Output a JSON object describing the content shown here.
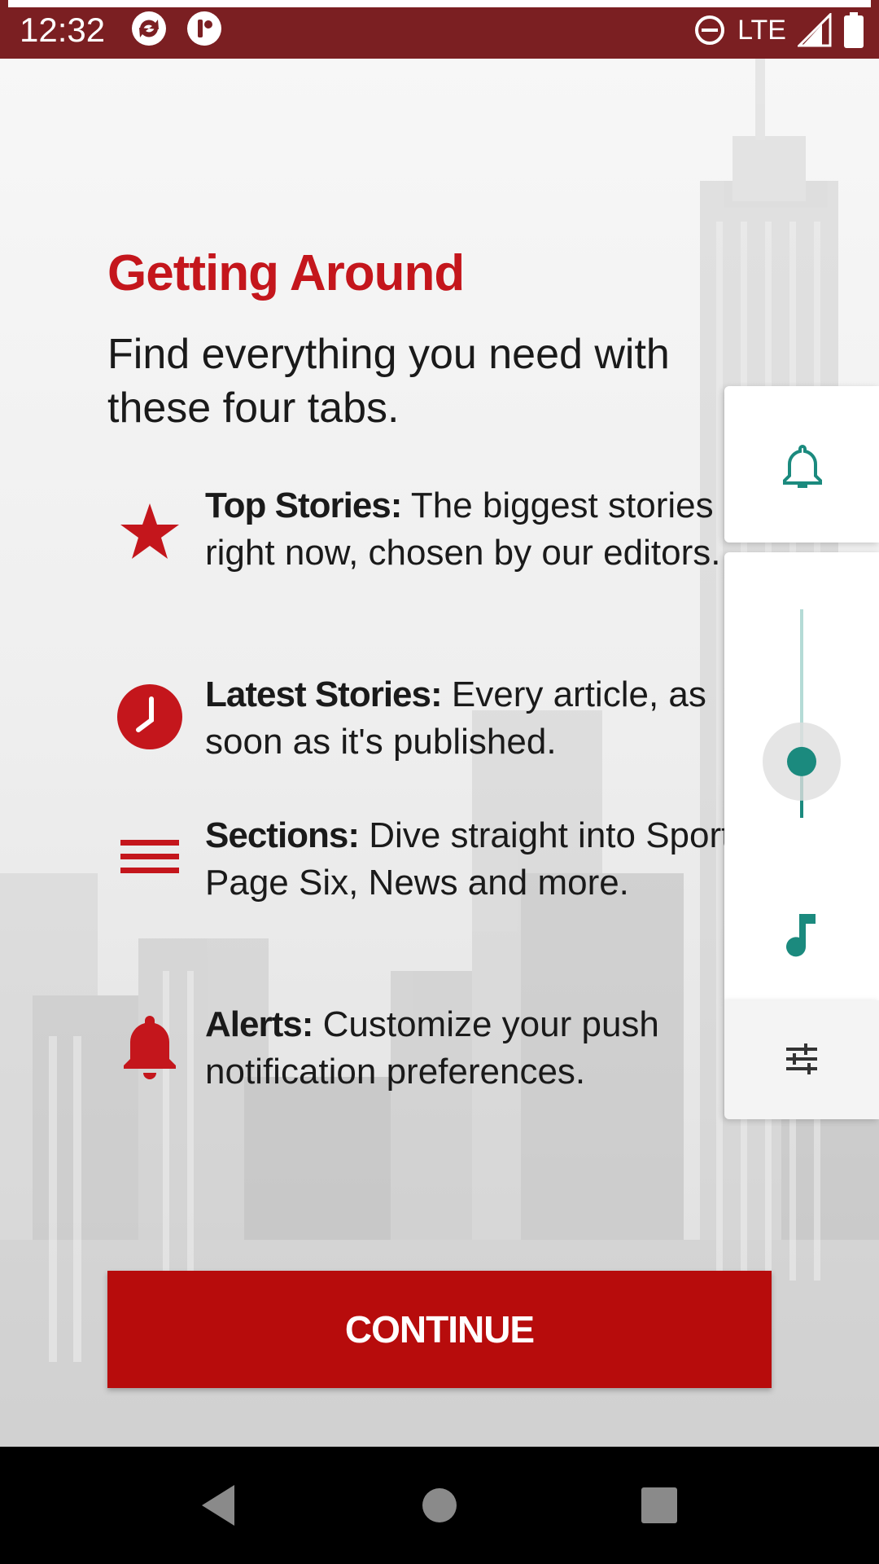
{
  "status_bar": {
    "time": "12:32",
    "network": "LTE"
  },
  "onboarding": {
    "title": "Getting Around",
    "intro": "Find everything you need with these four tabs.",
    "tabs": [
      {
        "name": "Top Stories:",
        "description": "The biggest stories right now, chosen by our editors.",
        "icon": "star-icon"
      },
      {
        "name": "Latest Stories:",
        "description": "Every article, as soon as it's published.",
        "icon": "clock-icon"
      },
      {
        "name": "Sections:",
        "description": "Dive straight into Sports, Page Six, News and more.",
        "icon": "menu-icon"
      },
      {
        "name": "Alerts:",
        "description": "Customize your push notification preferences.",
        "icon": "bell-icon"
      }
    ],
    "continue_label": "CONTINUE"
  },
  "volume_panel": {
    "level": 0.27
  },
  "colors": {
    "brand_red": "#c4161c",
    "button_red": "#b70c0c",
    "status_bar": "#7b1f22",
    "accent_teal": "#1b8a7e"
  }
}
